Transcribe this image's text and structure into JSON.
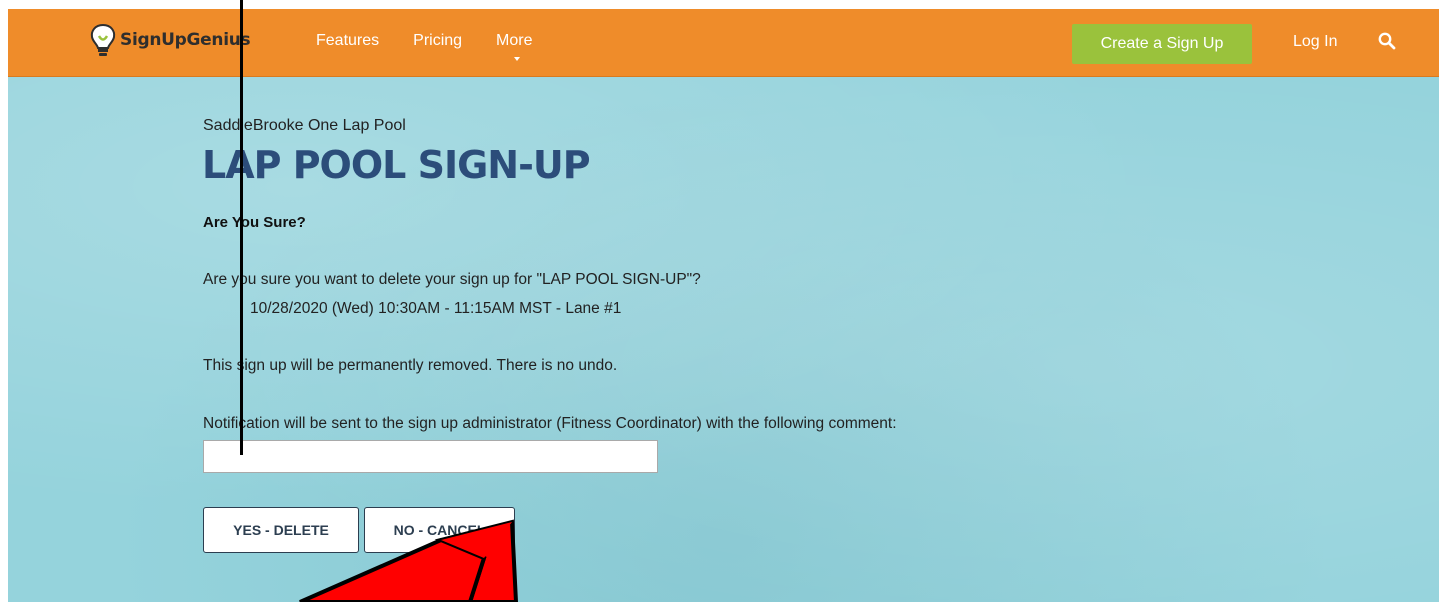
{
  "header": {
    "brand": "SignUpGenius",
    "nav": [
      "Features",
      "Pricing",
      "More"
    ],
    "create_label": "Create a Sign Up",
    "login_label": "Log In",
    "brand_color": "#ef8c2a",
    "create_color": "#9ac23c"
  },
  "main": {
    "org_name": "SaddleBrooke One Lap Pool",
    "title": "LAP POOL SIGN-UP",
    "confirm_heading": "Are You Sure?",
    "question": "Are you sure you want to delete your sign up for \"LAP POOL SIGN-UP\"?",
    "slot": "10/28/2020 (Wed) 10:30AM - 11:15AM MST - Lane #1",
    "warning": "This sign up will be permanently removed. There is no undo.",
    "notification": "Notification will be sent to the sign up administrator (Fitness Coordinator) with the following comment:",
    "comment_value": "",
    "yes_label": "YES - DELETE",
    "no_label": "NO - CANCEL",
    "title_color": "#2c4d7a"
  },
  "annotations": {
    "icons": [
      "vertical-black-line-annotation",
      "red-arrow-annotation"
    ],
    "arrow_color": "#ff0000"
  }
}
